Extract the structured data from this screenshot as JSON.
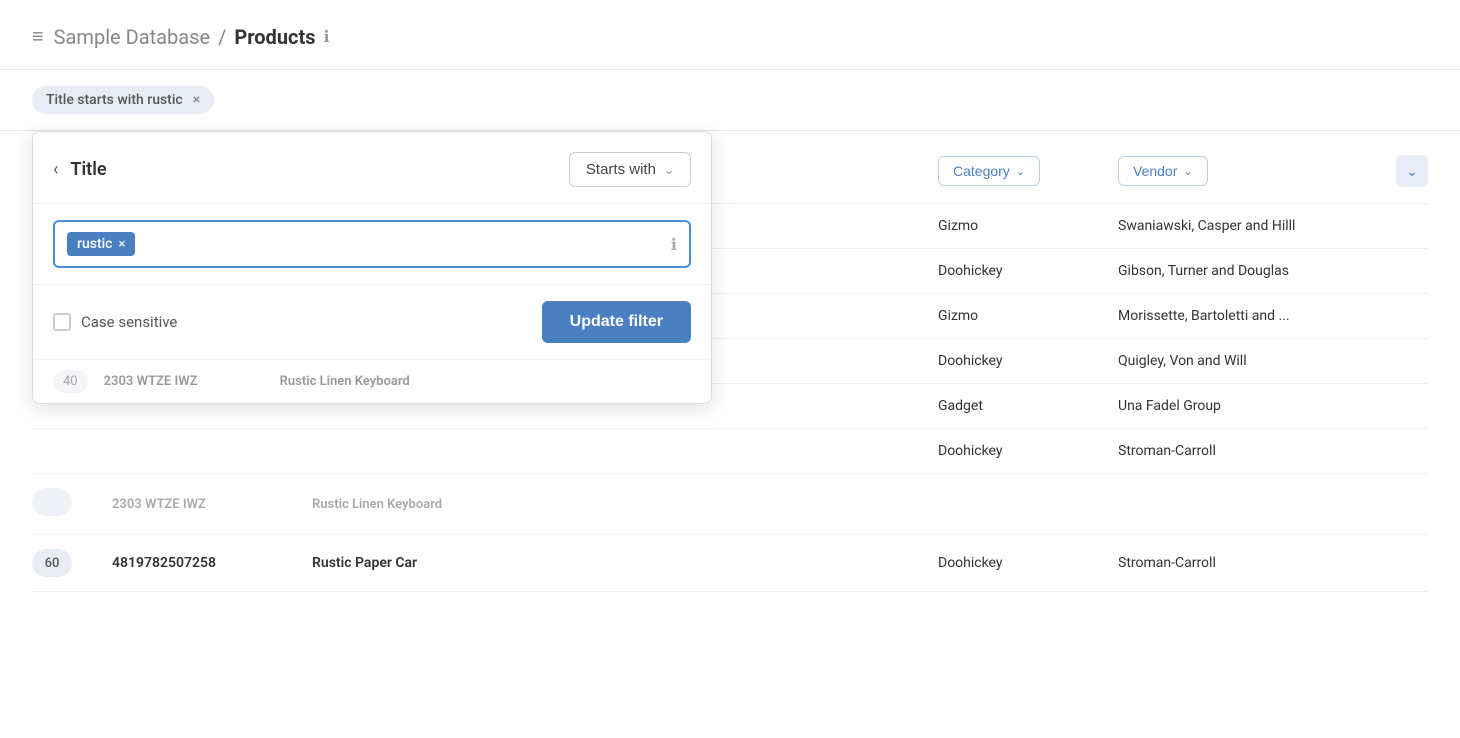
{
  "header": {
    "db_icon": "≡",
    "db_name": "Sample Database",
    "separator": "/",
    "table_name": "Products",
    "info_icon": "ℹ"
  },
  "toolbar": {
    "filter_badge_label": "Title starts with rustic",
    "filter_badge_close": "×"
  },
  "filter_panel": {
    "back_icon": "‹",
    "title": "Title",
    "condition": "Starts with",
    "chevron": "⌄",
    "tag_value": "rustic",
    "tag_close": "×",
    "input_placeholder": "",
    "info_icon": "ℹ",
    "case_sensitive_label": "Case sensitive",
    "update_button": "Update filter"
  },
  "table": {
    "columns": {
      "category": "Category",
      "vendor": "Vendor"
    },
    "chevron_btn": "⌄",
    "rows": [
      {
        "category": "Gizmo",
        "vendor": "Swaniawski, Casper and Hilll"
      },
      {
        "category": "Doohickey",
        "vendor": "Gibson, Turner and Douglas"
      },
      {
        "category": "Gizmo",
        "vendor": "Morissette, Bartoletti and ..."
      },
      {
        "category": "Doohickey",
        "vendor": "Quigley, Von and Will"
      },
      {
        "category": "Gadget",
        "vendor": "Una Fadel Group"
      },
      {
        "category": "Doohickey",
        "vendor": "Stroman-Carroll"
      }
    ],
    "bottom_rows": [
      {
        "id": "",
        "barcode": "2303 WTZE IWZ",
        "title": "Rustic Linen Keyboard",
        "category": "",
        "vendor": ""
      },
      {
        "id": "60",
        "barcode": "4819782507258",
        "title": "Rustic Paper Car",
        "category": "Doohickey",
        "vendor": "Stroman-Carroll"
      }
    ]
  }
}
